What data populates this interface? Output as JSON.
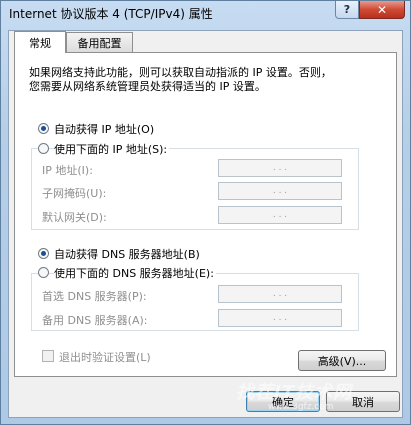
{
  "window": {
    "title": "Internet 协议版本 4 (TCP/IPv4) 属性",
    "help_label": "?",
    "close_label": "✕"
  },
  "tabs": [
    {
      "label": "常规",
      "active": true
    },
    {
      "label": "备用配置",
      "active": false
    }
  ],
  "description": {
    "line1": "如果网络支持此功能，则可以获取自动指派的 IP 设置。否则，",
    "line2": "您需要从网络系统管理员处获得适当的 IP 设置。"
  },
  "ip": {
    "auto_label": "自动获得 IP 地址(O)",
    "manual_label": "使用下面的 IP 地址(S):",
    "auto_selected": true,
    "fields": [
      {
        "label": "IP 地址(I):",
        "value": ". . ."
      },
      {
        "label": "子网掩码(U):",
        "value": ". . ."
      },
      {
        "label": "默认网关(D):",
        "value": ". . ."
      }
    ]
  },
  "dns": {
    "auto_label": "自动获得 DNS 服务器地址(B)",
    "manual_label": "使用下面的 DNS 服务器地址(E):",
    "auto_selected": true,
    "fields": [
      {
        "label": "首选 DNS 服务器(P):",
        "value": ". . ."
      },
      {
        "label": "备用 DNS 服务器(A):",
        "value": ". . ."
      }
    ]
  },
  "validate_on_exit": {
    "label": "退出时验证设置(L)",
    "checked": false
  },
  "buttons": {
    "advanced": "高级(V)...",
    "ok": "确定",
    "cancel": "取消"
  },
  "watermark": {
    "main": "找茬IT技术网",
    "sub": "www.3gfz.com"
  },
  "colors": {
    "title_bar": "#b5cfe9",
    "close_button": "#cf4b36",
    "radio_dot": "#1d4f93"
  }
}
